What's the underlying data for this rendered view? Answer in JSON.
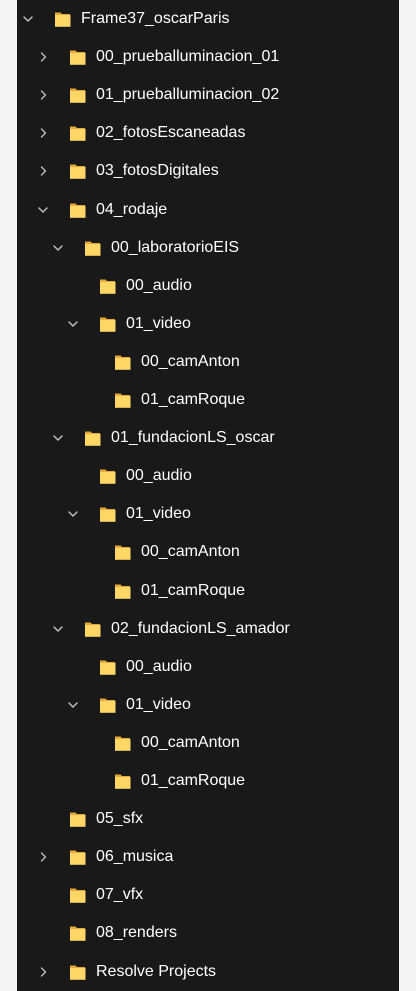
{
  "colors": {
    "panel_background": "#191919",
    "page_background": "#f4f4f4",
    "text": "#ffffff",
    "chevron": "#bdbdbd",
    "folder_body": "#ffd766",
    "folder_back": "#e7a83a"
  },
  "icons": {
    "expanded": "chevron-down-icon",
    "collapsed": "chevron-right-icon",
    "folder": "folder-icon"
  },
  "tree": {
    "items": [
      {
        "label": "Frame37_oscarParis",
        "depth": 0,
        "toggle": "expanded"
      },
      {
        "label": "00_prueballuminacion_01",
        "depth": 1,
        "toggle": "collapsed"
      },
      {
        "label": "01_prueballuminacion_02",
        "depth": 1,
        "toggle": "collapsed"
      },
      {
        "label": "02_fotosEscaneadas",
        "depth": 1,
        "toggle": "collapsed"
      },
      {
        "label": "03_fotosDigitales",
        "depth": 1,
        "toggle": "collapsed"
      },
      {
        "label": "04_rodaje",
        "depth": 1,
        "toggle": "expanded"
      },
      {
        "label": "00_laboratorioEIS",
        "depth": 2,
        "toggle": "expanded"
      },
      {
        "label": "00_audio",
        "depth": 3,
        "toggle": "none"
      },
      {
        "label": "01_video",
        "depth": 3,
        "toggle": "expanded"
      },
      {
        "label": "00_camAnton",
        "depth": 4,
        "toggle": "none"
      },
      {
        "label": "01_camRoque",
        "depth": 4,
        "toggle": "none"
      },
      {
        "label": "01_fundacionLS_oscar",
        "depth": 2,
        "toggle": "expanded"
      },
      {
        "label": "00_audio",
        "depth": 3,
        "toggle": "none"
      },
      {
        "label": "01_video",
        "depth": 3,
        "toggle": "expanded"
      },
      {
        "label": "00_camAnton",
        "depth": 4,
        "toggle": "none"
      },
      {
        "label": "01_camRoque",
        "depth": 4,
        "toggle": "none"
      },
      {
        "label": "02_fundacionLS_amador",
        "depth": 2,
        "toggle": "expanded"
      },
      {
        "label": "00_audio",
        "depth": 3,
        "toggle": "none"
      },
      {
        "label": "01_video",
        "depth": 3,
        "toggle": "expanded"
      },
      {
        "label": "00_camAnton",
        "depth": 4,
        "toggle": "none"
      },
      {
        "label": "01_camRoque",
        "depth": 4,
        "toggle": "none"
      },
      {
        "label": "05_sfx",
        "depth": 1,
        "toggle": "none"
      },
      {
        "label": "06_musica",
        "depth": 1,
        "toggle": "collapsed"
      },
      {
        "label": "07_vfx",
        "depth": 1,
        "toggle": "none"
      },
      {
        "label": "08_renders",
        "depth": 1,
        "toggle": "none"
      },
      {
        "label": "Resolve Projects",
        "depth": 1,
        "toggle": "collapsed"
      }
    ]
  }
}
